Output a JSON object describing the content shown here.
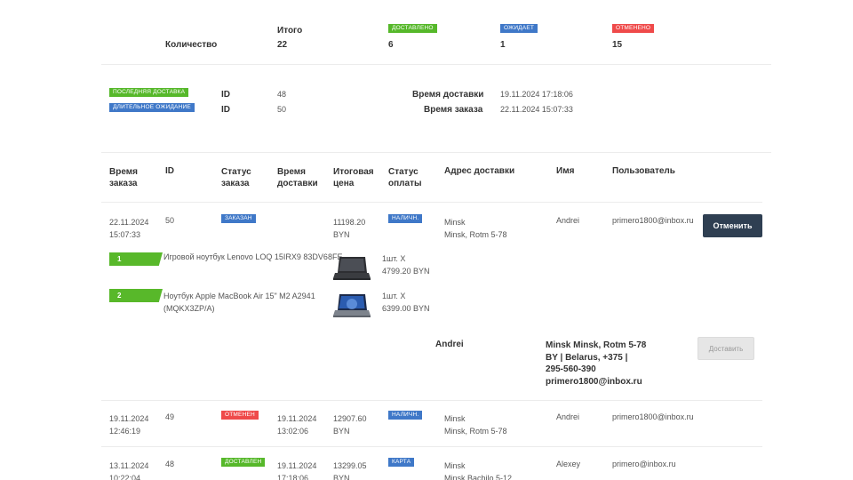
{
  "summary": {
    "quantity_label": "Количество",
    "total_label": "Итого",
    "total_value": "22",
    "delivered_badge": "ДОСТАВЛЕНО",
    "delivered_value": "6",
    "waiting_badge": "ОЖИДАЕТ",
    "waiting_value": "1",
    "cancelled_badge": "ОТМЕНЕНО",
    "cancelled_value": "15"
  },
  "info": {
    "last_delivery_badge": "ПОСЛЕДНЯЯ ДОСТАВКА",
    "long_wait_badge": "ДЛИТЕЛЬНОЕ ОЖИДАНИЕ",
    "id_label": "ID",
    "last_delivery_id": "48",
    "long_wait_id": "50",
    "delivery_time_label": "Время доставки",
    "delivery_time_value": "19.11.2024 17:18:06",
    "order_time_label": "Время заказа",
    "order_time_value": "22.11.2024 15:07:33"
  },
  "table": {
    "headers": {
      "order_time": [
        "Время",
        "заказа"
      ],
      "id": "ID",
      "order_status": [
        "Статус",
        "заказа"
      ],
      "delivery_time": [
        "Время",
        "доставки"
      ],
      "total_price": [
        "Итоговая",
        "цена"
      ],
      "payment_status": [
        "Статус",
        "оплаты"
      ],
      "address": "Адрес доставки",
      "name": "Имя",
      "user": "Пользователь"
    },
    "rows": [
      {
        "date": "22.11.2024",
        "time": "15:07:33",
        "id": "50",
        "status": "ЗАКАЗАН",
        "delivery_date": "",
        "delivery_time": "",
        "price": "11198.20",
        "currency": "BYN",
        "payment": "НАЛИЧН.",
        "city": "Minsk",
        "address": "Minsk, Rotm 5-78",
        "name": "Andrei",
        "user": "primero1800@inbox.ru",
        "action": "Отменить"
      },
      {
        "date": "19.11.2024",
        "time": "12:46:19",
        "id": "49",
        "status": "ОТМЕНЕН",
        "delivery_date": "19.11.2024",
        "delivery_time": "13:02:06",
        "price": "12907.60",
        "currency": "BYN",
        "payment": "НАЛИЧН.",
        "city": "Minsk",
        "address": "Minsk, Rotm 5-78",
        "name": "Andrei",
        "user": "primero1800@inbox.ru"
      },
      {
        "date": "13.11.2024",
        "time": "10:22:04",
        "id": "48",
        "status": "ДОСТАВЛЕН",
        "delivery_date": "19.11.2024",
        "delivery_time": "17:18:06",
        "price": "13299.05",
        "currency": "BYN",
        "payment": "КАРТА",
        "city": "Minsk",
        "address": "Minsk Bachilo 5-12",
        "name": "Alexey",
        "user": "primero@inbox.ru"
      }
    ]
  },
  "items": [
    {
      "num": "1",
      "title": "Игровой ноутбук Lenovo LOQ 15IRX9 83DV68FE",
      "title2": "",
      "qty": "1шт. X",
      "price": "4799.20 BYN"
    },
    {
      "num": "2",
      "title": "Ноутбук Apple MacBook Air 15\" M2 A2941",
      "title2": "(MQKX3ZP/A)",
      "qty": "1шт. X",
      "price": "6399.00 BYN"
    }
  ],
  "delivery_block": {
    "name": "Andrei",
    "address_line1": "Minsk Minsk, Rotm 5-78",
    "address_line2": "BY | Belarus, +375 |",
    "address_line3": "295-560-390",
    "address_line4": "primero1800@inbox.ru",
    "deliver_button": "Доставить"
  },
  "colors": {
    "green": "#56b82a",
    "blue": "#3f78c8",
    "red": "#ef4a4a",
    "dark_button": "#2f3f52"
  }
}
